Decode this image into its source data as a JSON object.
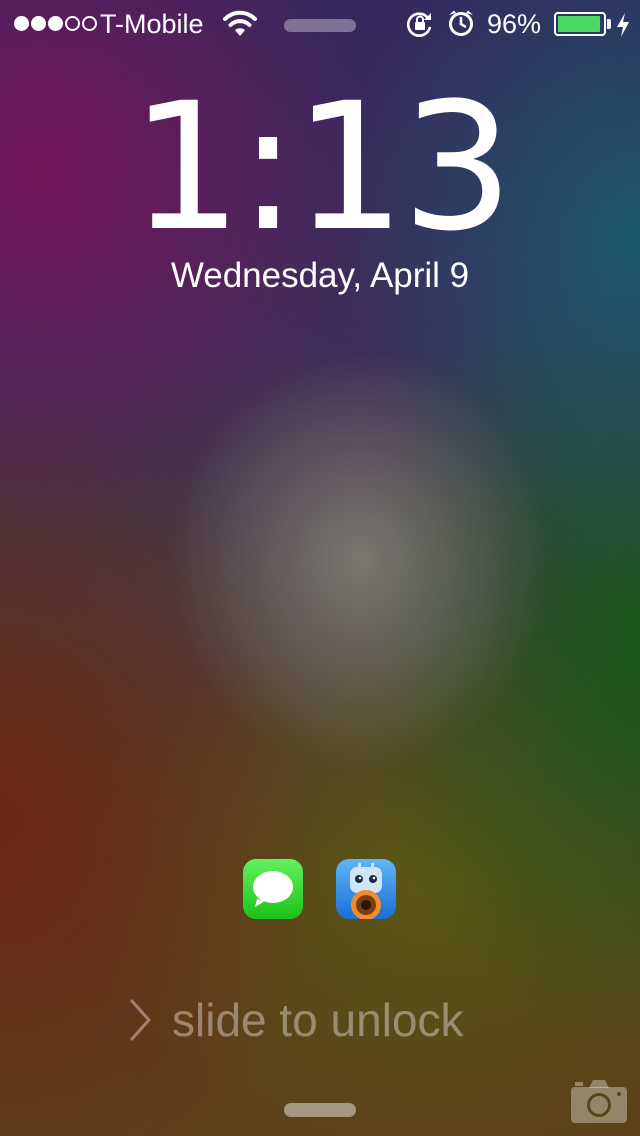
{
  "status_bar": {
    "signal_bars_total": 5,
    "signal_bars_filled": 3,
    "carrier": "T-Mobile",
    "battery_percent_label": "96%",
    "battery_level": 0.96,
    "battery_color": "#4cd964",
    "icons": [
      "wifi-icon",
      "rotation-lock-icon",
      "alarm-clock-icon",
      "charging-bolt-icon"
    ]
  },
  "lock_screen": {
    "time": "1:13",
    "date": "Wednesday, April 9",
    "slide_to_unlock": "slide to unlock"
  },
  "apps": [
    {
      "name": "Messages",
      "icon": "messages-icon"
    },
    {
      "name": "Tweetbot",
      "icon": "tweetbot-icon"
    }
  ],
  "camera_icon": "camera-icon"
}
